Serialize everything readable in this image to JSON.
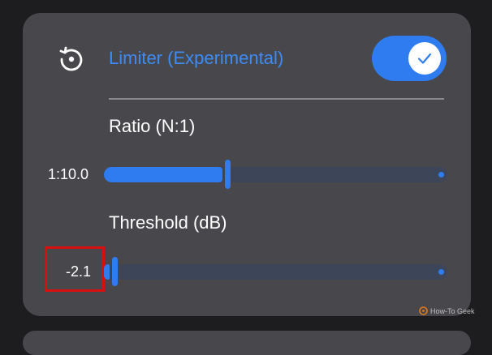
{
  "limiter": {
    "title": "Limiter (Experimental)",
    "enabled": true,
    "accent_color": "#2e7cf0"
  },
  "ratio": {
    "label": "Ratio (N:1)",
    "value": "1:10.0",
    "fraction": 0.36
  },
  "threshold": {
    "label": "Threshold (dB)",
    "value": "-2.1",
    "fraction": 0.03
  },
  "icons": {
    "reset": "reset-icon",
    "check": "check-icon",
    "watermark": "howtogeek-logo"
  },
  "watermark": {
    "text": "How-To Geek"
  },
  "highlight_color": "#d90f0f"
}
